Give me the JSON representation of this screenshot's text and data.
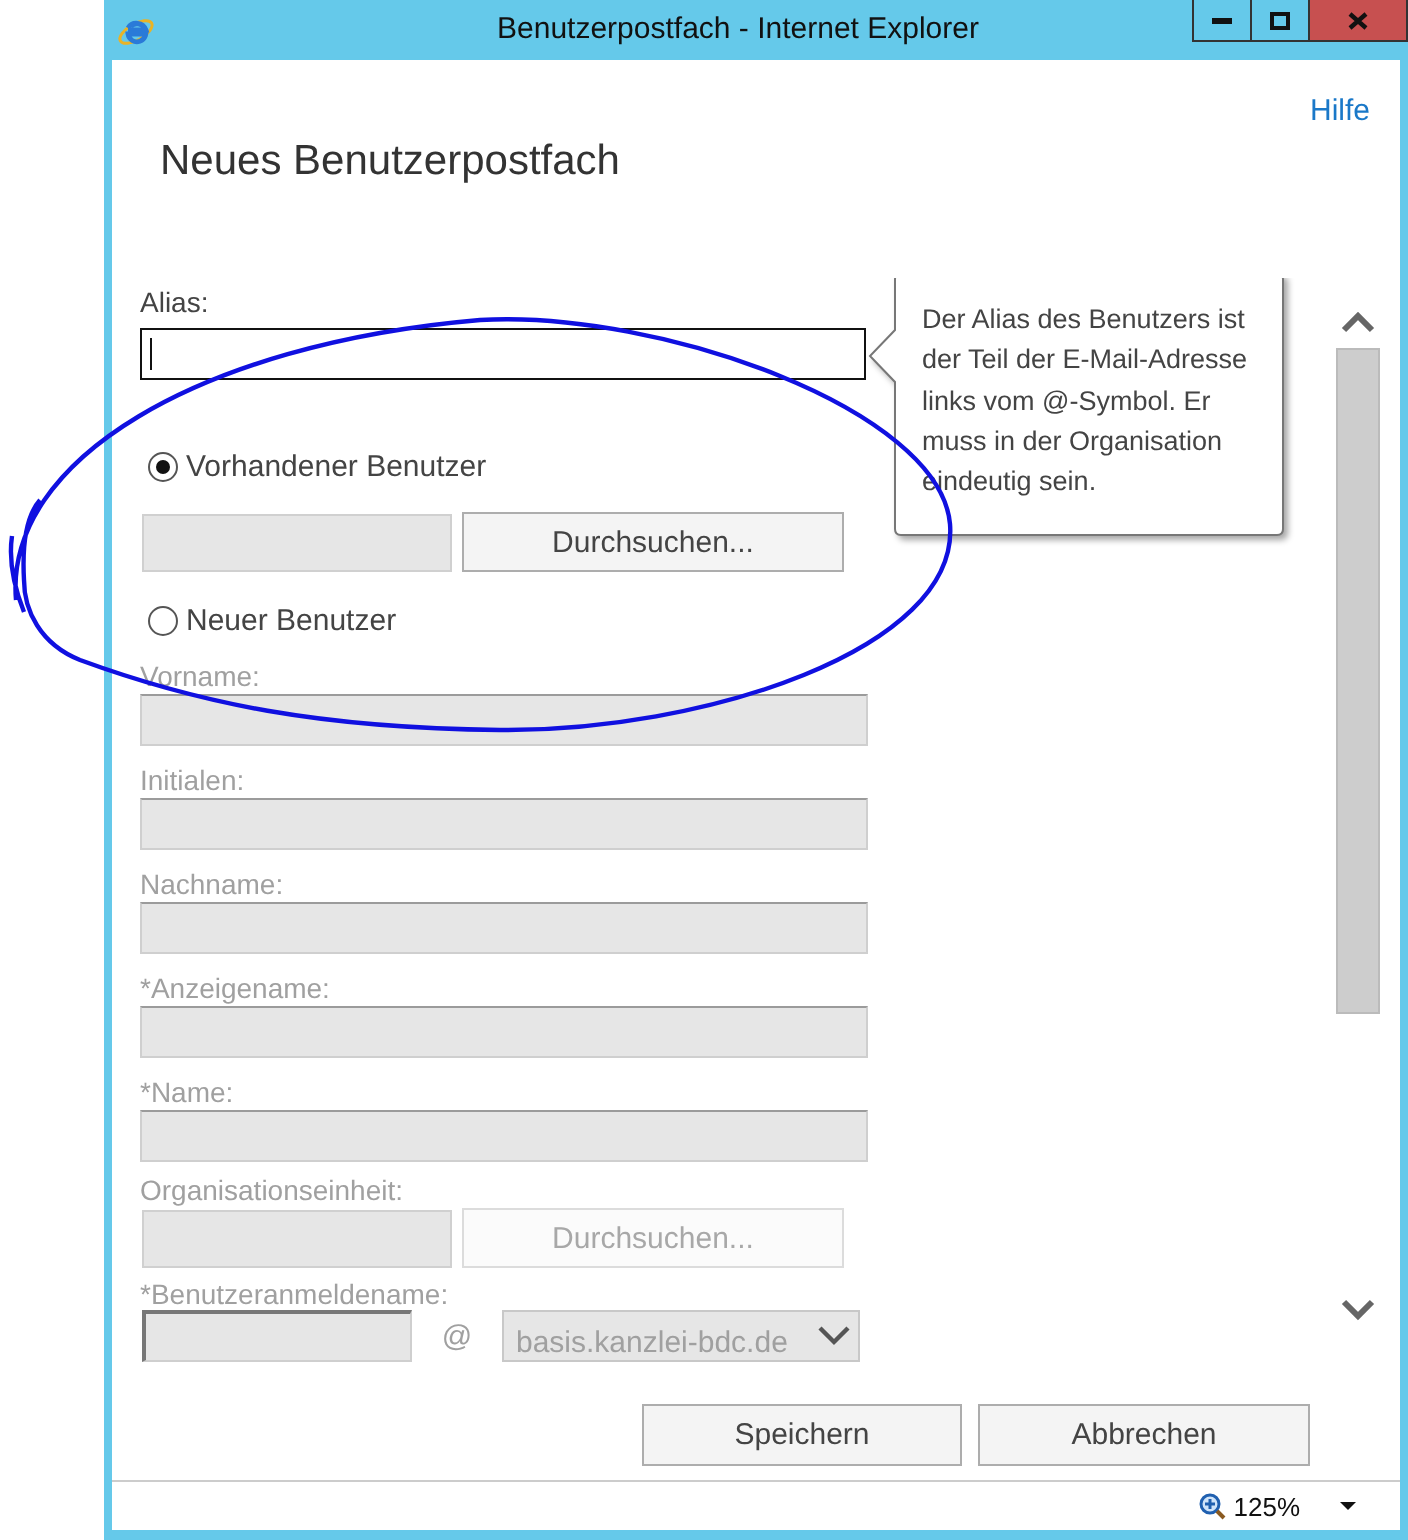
{
  "window": {
    "title": "Benutzerpostfach - Internet Explorer"
  },
  "help_link": "Hilfe",
  "heading": "Neues Benutzerpostfach",
  "alias": {
    "label": "Alias:",
    "focused": true
  },
  "tooltip": "Der Alias des Benutzers ist der Teil der E-Mail-Adresse links vom @-Symbol. Er muss in der Organisation eindeutig sein.",
  "user_options": [
    {
      "label": "Vorhandener Benutzer",
      "selected": true
    },
    {
      "label": "Neuer Benutzer",
      "selected": false
    }
  ],
  "existing_user": {
    "button": "Durchsuchen...",
    "disabled": false
  },
  "fields": [
    {
      "label": "Vorname:",
      "disabled": true
    },
    {
      "label": "Initialen:",
      "disabled": true
    },
    {
      "label": "Nachname:",
      "disabled": true
    },
    {
      "label": "*Anzeigename:",
      "disabled": true
    },
    {
      "label": "*Name:",
      "disabled": true
    }
  ],
  "org_unit": {
    "label": "Organisationseinheit:",
    "button": "Durchsuchen...",
    "disabled": true
  },
  "logon": {
    "label": "*Benutzeranmeldename:",
    "at": "@",
    "domain": "basis.kanzlei-bdc.de",
    "disabled": true
  },
  "buttons": [
    "Speichern",
    "Abbrechen"
  ],
  "status_bar": {
    "zoom": "125%"
  }
}
